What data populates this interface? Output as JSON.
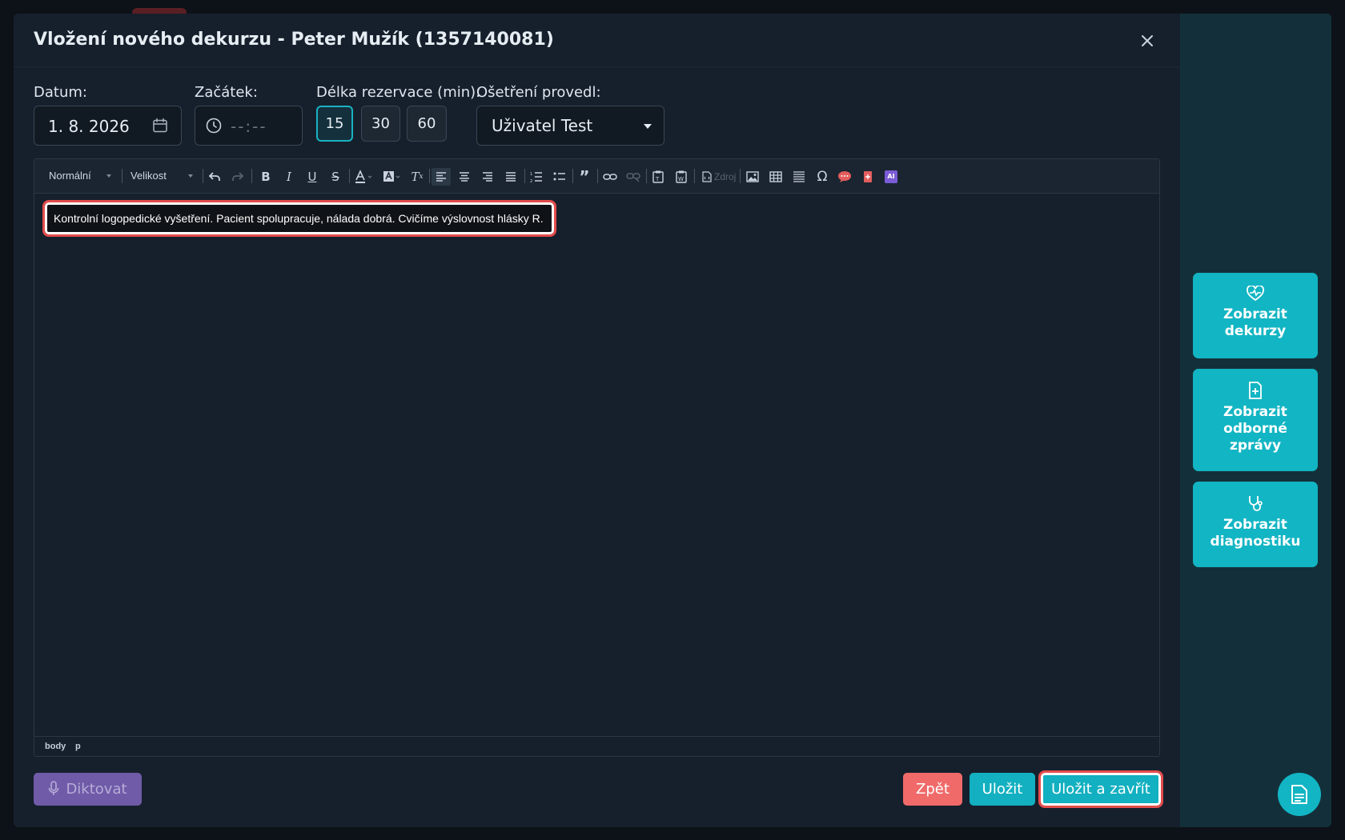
{
  "dialog": {
    "title": "Vložení nového dekurzu - Peter Mužík (1357140081)"
  },
  "form": {
    "date_label": "Datum:",
    "date_value": "1. 8. 2026",
    "start_label": "Začátek:",
    "start_placeholder": "--:--",
    "duration_label": "Délka rezervace (min):",
    "durations": [
      "15",
      "30",
      "60"
    ],
    "duration_selected": "15",
    "performed_by_label": "Ošetření provedl:",
    "performed_by_value": "Uživatel Test"
  },
  "toolbar": {
    "format_combo": "Normální",
    "size_combo": "Velikost",
    "source_label": "Zdroj",
    "ai_label": "AI",
    "icons": [
      "undo-icon",
      "redo-icon",
      "bold-icon",
      "italic-icon",
      "underline-icon",
      "strikethrough-icon",
      "text-color-icon",
      "background-color-icon",
      "remove-format-icon",
      "align-left-icon",
      "align-center-icon",
      "align-right-icon",
      "align-justify-icon",
      "numbered-list-icon",
      "bulleted-list-icon",
      "blockquote-icon",
      "link-icon",
      "unlink-icon",
      "paste-text-icon",
      "paste-word-icon",
      "source-icon",
      "image-icon",
      "table-icon",
      "horizontal-line-icon",
      "special-char-icon",
      "comment-icon",
      "template-icon",
      "ai-icon"
    ]
  },
  "editor": {
    "content": "Kontrolní logopedické vyšetření. Pacient spolupracuje, nálada dobrá. Cvičíme výslovnost hlásky R.",
    "path": [
      "body",
      "p"
    ]
  },
  "footer": {
    "dictate_label": "Diktovat",
    "back_label": "Zpět",
    "save_label": "Uložit",
    "save_close_label": "Uložit a zavřít"
  },
  "side_panel": {
    "items": [
      {
        "label_line1": "Zobrazit",
        "label_line2": "dekurzy",
        "icon": "heart-pulse-icon"
      },
      {
        "label_line1": "Zobrazit",
        "label_line2": "odborné",
        "label_line3": "zprávy",
        "icon": "file-plus-icon"
      },
      {
        "label_line1": "Zobrazit",
        "label_line2": "diagnostiku",
        "icon": "stethoscope-icon"
      }
    ]
  },
  "colors": {
    "accent": "#12b5c3",
    "danger": "#f06a6a",
    "dictate": "#6f5ba8",
    "highlight": "#e34c4c"
  }
}
